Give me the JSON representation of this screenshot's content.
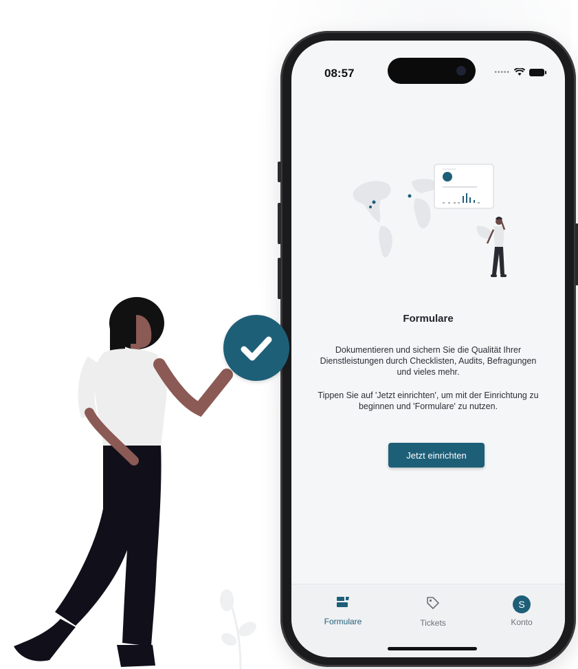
{
  "status_bar": {
    "time": "08:57"
  },
  "content": {
    "title": "Formulare",
    "paragraph_1": "Dokumentieren und sichern Sie die Qualität Ihrer Dienstleistungen durch Checklisten, Audits, Befragungen und vieles mehr.",
    "paragraph_2": "Tippen Sie auf 'Jetzt einrichten', um mit der Einrichtung zu beginnen und 'Formulare' zu nutzen.",
    "cta_label": "Jetzt einrichten"
  },
  "tabbar": {
    "items": [
      {
        "label": "Formulare",
        "icon": "forms-icon",
        "active": true
      },
      {
        "label": "Tickets",
        "icon": "tag-icon",
        "active": false
      },
      {
        "label": "Konto",
        "icon": "avatar",
        "avatar_letter": "S",
        "active": false
      }
    ]
  },
  "colors": {
    "accent": "#1e5f78",
    "screen_bg": "#f5f6f8",
    "inactive": "#6b7077"
  }
}
